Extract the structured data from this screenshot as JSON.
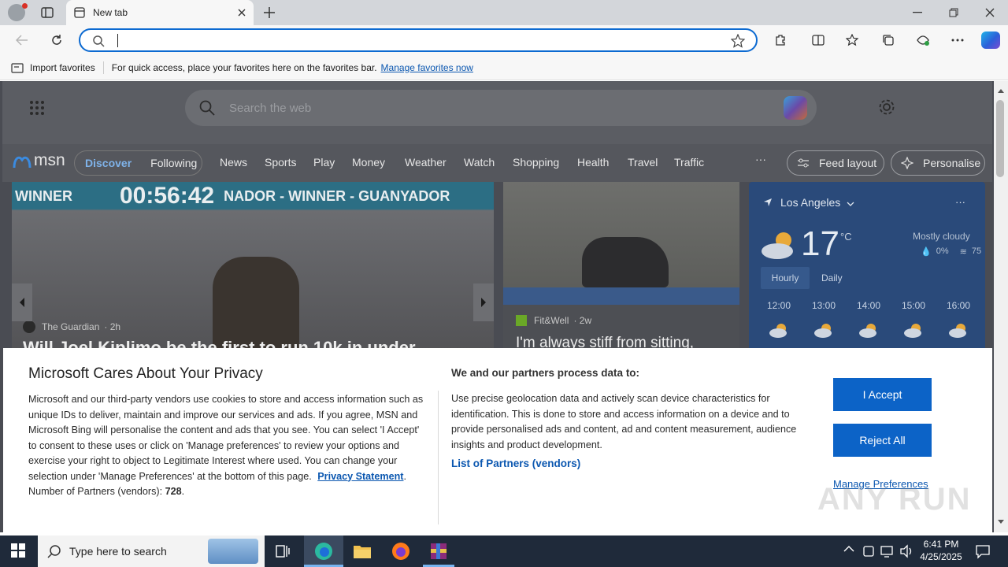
{
  "tab": {
    "title": "New tab"
  },
  "favbar": {
    "import_label": "Import favorites",
    "hint": "For quick access, place your favorites here on the favorites bar.",
    "manage_link": "Manage favorites now"
  },
  "msn": {
    "search_placeholder": "Search the web",
    "brand": "msn",
    "nav_pills": [
      "Discover",
      "Following"
    ],
    "nav_links": [
      "News",
      "Sports",
      "Play",
      "Money",
      "Weather",
      "Watch",
      "Shopping",
      "Health",
      "Travel",
      "Traffic"
    ],
    "more": "···",
    "feed_layout": "Feed layout",
    "personalise": "Personalise",
    "hero": {
      "banner_left": "WINNER",
      "banner_time": "00:56:42",
      "banner_right": "NADOR - WINNER - GUANYADOR",
      "source": "The Guardian",
      "age": "2h",
      "headline": "Will Joel Kiplimo be the first to run 10k in under..."
    },
    "card2": {
      "source": "Fit&Well",
      "age": "2w",
      "headline": "I'm always stiff from sitting,"
    },
    "weather": {
      "location": "Los Angeles",
      "temp": "17",
      "unit": "°C",
      "condition": "Mostly cloudy",
      "precip": "0%",
      "wind": "75",
      "tabs": [
        "Hourly",
        "Daily"
      ],
      "hours": [
        "12:00",
        "13:00",
        "14:00",
        "15:00",
        "16:00"
      ]
    }
  },
  "privacy": {
    "title": "Microsoft Cares About Your Privacy",
    "body": "Microsoft and our third-party vendors use cookies to store and access information such as unique IDs to deliver, maintain and improve our services and ads. If you agree, MSN and Microsoft Bing will personalise the content and ads that you see. You can select 'I Accept' to consent to these uses or click on 'Manage preferences' to review your options and exercise your right to object to Legitimate Interest where used.  You can change your selection under 'Manage Preferences' at the bottom of this page.",
    "privacy_link": "Privacy Statement",
    "partners_label": "Number of Partners (vendors):",
    "partners_count": "728",
    "right_title": "We and our partners process data to:",
    "right_body": "Use precise geolocation data and actively scan device characteristics for identification. This is done to store and access information on a device and to provide personalised ads and content, ad and content measurement, audience insights and product development.",
    "partners_link": "List of Partners (vendors)",
    "accept": "I Accept",
    "reject": "Reject All",
    "manage": "Manage Preferences"
  },
  "taskbar": {
    "search_placeholder": "Type here to search",
    "time": "6:41 PM",
    "date": "4/25/2025"
  },
  "watermark": "ANY RUN"
}
